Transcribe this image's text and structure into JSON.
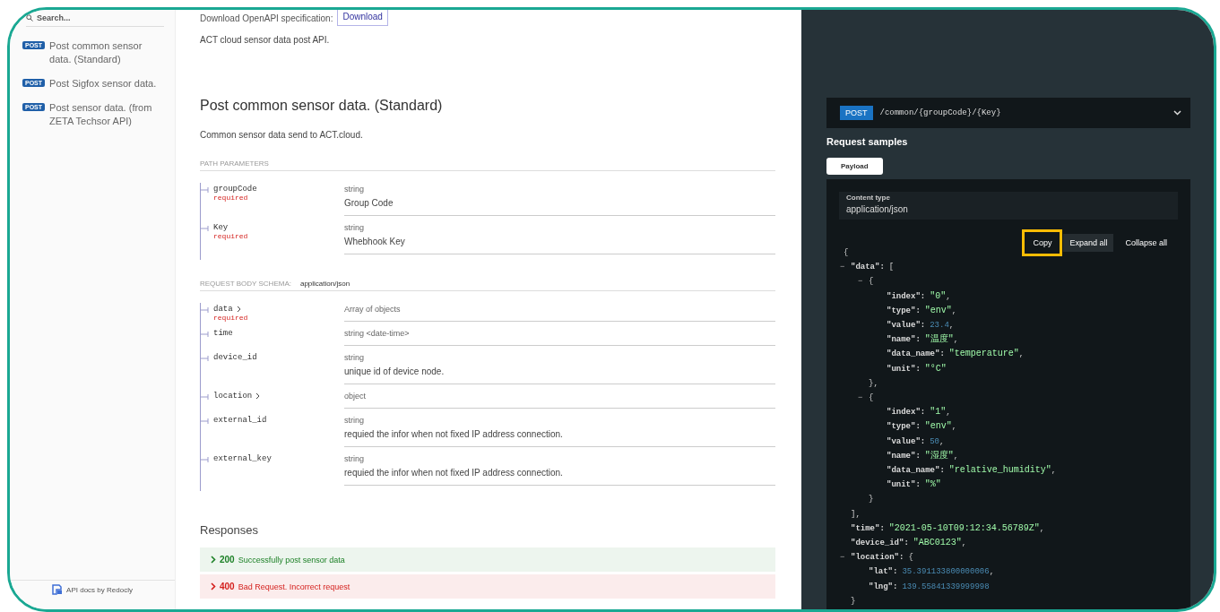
{
  "sidebar": {
    "search": {
      "placeholder": "Search..."
    },
    "items": [
      {
        "method": "POST",
        "label": "Post common sensor data. (Standard)"
      },
      {
        "method": "POST",
        "label": "Post Sigfox sensor data."
      },
      {
        "method": "POST",
        "label": "Post sensor data. (from ZETA Techsor API)"
      }
    ],
    "footer": "API docs by Redocly"
  },
  "main": {
    "download_label": "Download OpenAPI specification:",
    "download_button": "Download",
    "description": "ACT cloud sensor data post API.",
    "operation": {
      "title": "Post common sensor data. (Standard)",
      "description": "Common sensor data send to ACT.cloud.",
      "path_parameters_heading": "PATH PARAMETERS",
      "path_parameters": [
        {
          "name": "groupCode",
          "required": "required",
          "type": "string",
          "description": "Group Code",
          "expandable": false
        },
        {
          "name": "Key",
          "required": "required",
          "type": "string",
          "description": "Whebhook Key",
          "expandable": false
        }
      ],
      "body_heading": "REQUEST BODY SCHEMA:",
      "body_content_type": "application/json",
      "body_parameters": [
        {
          "name": "data",
          "required": "required",
          "type": "Array of objects",
          "expandable": true
        },
        {
          "name": "time",
          "type": "string <date-time>",
          "expandable": false
        },
        {
          "name": "device_id",
          "type": "string",
          "description": "unique id of device node.",
          "expandable": false
        },
        {
          "name": "location",
          "type": "object",
          "expandable": true
        },
        {
          "name": "external_id",
          "type": "string",
          "description": "requied the infor when not fixed IP address connection.",
          "expandable": false
        },
        {
          "name": "external_key",
          "type": "string",
          "description": "requied the infor when not fixed IP address connection.",
          "expandable": false
        }
      ],
      "responses_heading": "Responses",
      "responses": [
        {
          "code": "200",
          "label": "Successfully post sensor data",
          "kind": "success"
        },
        {
          "code": "400",
          "label": "Bad Request. Incorrect request",
          "kind": "error"
        }
      ]
    }
  },
  "panel": {
    "method": "POST",
    "path": "/common/{groupCode}/{Key}",
    "heading": "Request samples",
    "tabs": [
      {
        "label": "Payload",
        "selected": true
      }
    ],
    "content_type_label": "Content type",
    "content_type": "application/json",
    "actions": [
      {
        "label": "Copy",
        "highlighted": true,
        "hover": false
      },
      {
        "label": "Expand all",
        "highlighted": false,
        "hover": true
      },
      {
        "label": "Collapse all",
        "highlighted": false,
        "hover": false
      }
    ],
    "sample": {
      "open": "{",
      "children": [
        {
          "toggle": "−",
          "key": "\"data\":",
          "open": "[",
          "close": "],",
          "children": [
            {
              "toggle": "−",
              "open": "{",
              "close": "},",
              "children": [
                {
                  "key": "\"index\":",
                  "value": "\"0\"",
                  "kind": "string",
                  "punct": ","
                },
                {
                  "key": "\"type\":",
                  "value": "\"env\"",
                  "kind": "string",
                  "punct": ","
                },
                {
                  "key": "\"value\":",
                  "value": "23.4",
                  "kind": "number",
                  "punct": ","
                },
                {
                  "key": "\"name\":",
                  "value": "\"温度\"",
                  "kind": "string",
                  "punct": ","
                },
                {
                  "key": "\"data_name\":",
                  "value": "\"temperature\"",
                  "kind": "string",
                  "punct": ","
                },
                {
                  "key": "\"unit\":",
                  "value": "\"°C\"",
                  "kind": "string"
                }
              ]
            },
            {
              "toggle": "−",
              "open": "{",
              "close": "}",
              "children": [
                {
                  "key": "\"index\":",
                  "value": "\"1\"",
                  "kind": "string",
                  "punct": ","
                },
                {
                  "key": "\"type\":",
                  "value": "\"env\"",
                  "kind": "string",
                  "punct": ","
                },
                {
                  "key": "\"value\":",
                  "value": "50",
                  "kind": "number",
                  "punct": ","
                },
                {
                  "key": "\"name\":",
                  "value": "\"湿度\"",
                  "kind": "string",
                  "punct": ","
                },
                {
                  "key": "\"data_name\":",
                  "value": "\"relative_humidity\"",
                  "kind": "string",
                  "punct": ","
                },
                {
                  "key": "\"unit\":",
                  "value": "\"%\"",
                  "kind": "string"
                }
              ]
            }
          ]
        },
        {
          "key": "\"time\":",
          "value": "\"2021-05-10T09:12:34.56789Z\"",
          "kind": "string",
          "punct": ","
        },
        {
          "key": "\"device_id\":",
          "value": "\"ABC0123\"",
          "kind": "string",
          "punct": ","
        },
        {
          "toggle": "−",
          "key": "\"location\":",
          "open": "{",
          "close": "}",
          "children": [
            {
              "key": "\"lat\":",
              "value": "35.391133800000006",
              "kind": "number",
              "punct": ","
            },
            {
              "key": "\"lng\":",
              "value": "139.55841339999998",
              "kind": "number"
            }
          ]
        }
      ]
    }
  }
}
